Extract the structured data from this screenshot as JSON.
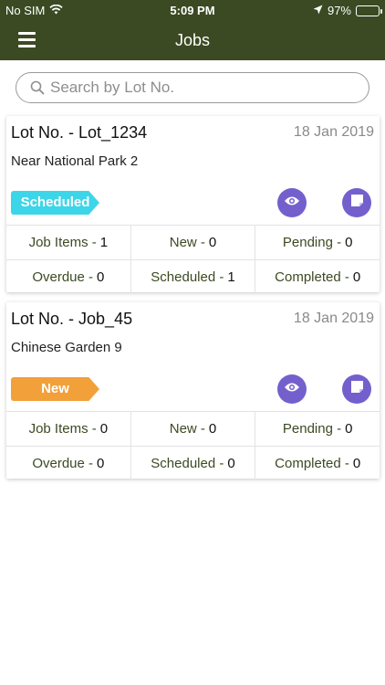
{
  "status_bar": {
    "carrier": "No SIM",
    "time": "5:09 PM",
    "battery": "97%",
    "battery_level": 0.97,
    "icons": [
      "wifi-icon",
      "location-arrow-icon",
      "battery-icon"
    ]
  },
  "nav": {
    "title": "Jobs",
    "menu_icon": "hamburger-menu-icon"
  },
  "search": {
    "placeholder": "Search by Lot No.",
    "value": "",
    "icon": "search-icon"
  },
  "colors": {
    "header": "#3b4a22",
    "stat_label": "#3b4a22",
    "action": "#7460cc",
    "badge_scheduled": "#3dd5e8",
    "badge_new": "#f2a03a"
  },
  "jobs": [
    {
      "lot": "Lot No. - Lot_1234",
      "date": "18 Jan 2019",
      "location": "Near National Park 2",
      "status": "Scheduled",
      "status_color": "#3dd5e8",
      "stats": {
        "job_items": {
          "label": "Job Items -",
          "value": "1"
        },
        "new": {
          "label": "New -",
          "value": "0"
        },
        "pending": {
          "label": "Pending -",
          "value": "0"
        },
        "overdue": {
          "label": "Overdue -",
          "value": "0"
        },
        "scheduled": {
          "label": "Scheduled -",
          "value": "1"
        },
        "completed": {
          "label": "Completed -",
          "value": "0"
        }
      }
    },
    {
      "lot": "Lot No. - Job_45",
      "date": "18 Jan 2019",
      "location": "Chinese Garden 9",
      "status": "New",
      "status_color": "#f2a03a",
      "stats": {
        "job_items": {
          "label": "Job Items -",
          "value": "0"
        },
        "new": {
          "label": "New -",
          "value": "0"
        },
        "pending": {
          "label": "Pending -",
          "value": "0"
        },
        "overdue": {
          "label": "Overdue -",
          "value": "0"
        },
        "scheduled": {
          "label": "Scheduled -",
          "value": "0"
        },
        "completed": {
          "label": "Completed -",
          "value": "0"
        }
      }
    }
  ]
}
